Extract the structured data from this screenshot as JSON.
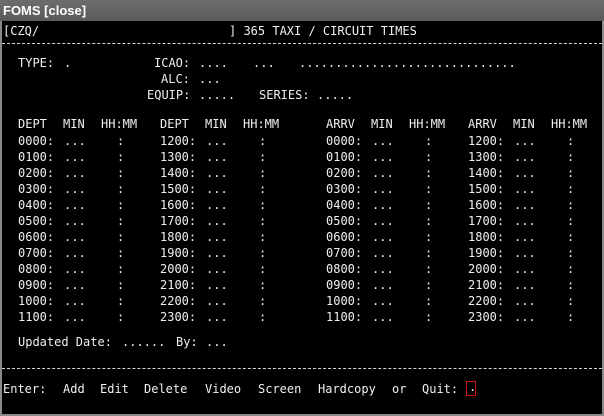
{
  "window": {
    "title": "FOMS [close]"
  },
  "header": {
    "center_code": "[CZQ/",
    "screen_title": "] 365 TAXI / CIRCUIT TIMES"
  },
  "form": {
    "type_label": "TYPE:",
    "type_value": ".",
    "icao_label": "ICAO:",
    "icao_value": "....",
    "icao_extra": "...",
    "icao_name_field": "..............................",
    "alc_label": "ALC:",
    "alc_value": "...",
    "equip_label": "EQUIP:",
    "equip_value": ".....",
    "series_label": "SERIES:",
    "series_value": "....."
  },
  "table": {
    "column_groups": [
      {
        "header": [
          "DEPT",
          "MIN",
          "HH:MM"
        ],
        "times": [
          "0000:",
          "0100:",
          "0200:",
          "0300:",
          "0400:",
          "0500:",
          "0600:",
          "0700:",
          "0800:",
          "0900:",
          "1000:",
          "1100:"
        ]
      },
      {
        "header": [
          "DEPT",
          "MIN",
          "HH:MM"
        ],
        "times": [
          "1200:",
          "1300:",
          "1400:",
          "1500:",
          "1600:",
          "1700:",
          "1800:",
          "1900:",
          "2000:",
          "2100:",
          "2200:",
          "2300:"
        ]
      },
      {
        "header": [
          "ARRV",
          "MIN",
          "HH:MM"
        ],
        "times": [
          "0000:",
          "0100:",
          "0200:",
          "0300:",
          "0400:",
          "0500:",
          "0600:",
          "0700:",
          "0800:",
          "0900:",
          "1000:",
          "1100:"
        ]
      },
      {
        "header": [
          "ARRV",
          "MIN",
          "HH:MM"
        ],
        "times": [
          "1200:",
          "1300:",
          "1400:",
          "1500:",
          "1600:",
          "1700:",
          "1800:",
          "1900:",
          "2000:",
          "2100:",
          "2200:",
          "2300:"
        ]
      }
    ],
    "min_placeholder": "...",
    "hhmm_placeholder": ":"
  },
  "footer_info": {
    "updated_label": "Updated Date:",
    "updated_value": "......",
    "by_label": "By:",
    "by_value": "..."
  },
  "command_line": {
    "prompt": "Enter:",
    "commands": [
      "Add",
      "Edit",
      "Delete",
      "Video",
      "Screen",
      "Hardcopy"
    ],
    "or_label": "or",
    "quit_label": "Quit:",
    "input_value": "."
  },
  "colors": {
    "background": "#000000",
    "text": "#f0f0f0",
    "cursor_border": "#d01010"
  }
}
